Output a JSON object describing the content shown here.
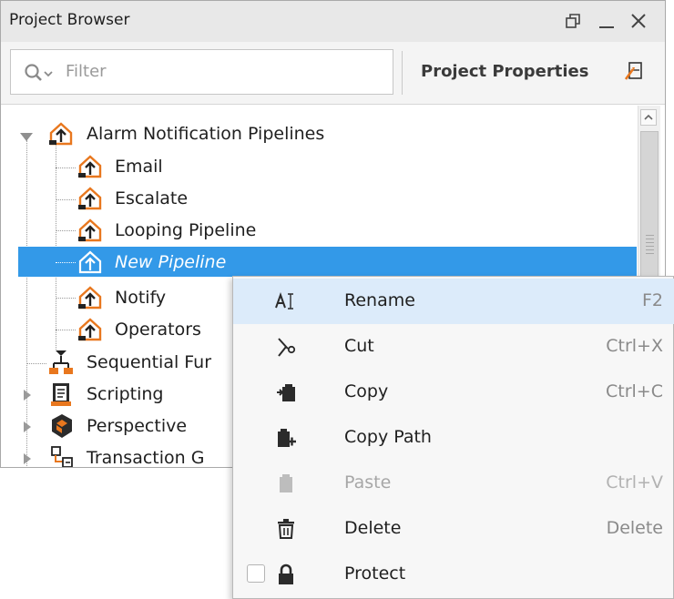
{
  "panel": {
    "title": "Project Browser",
    "filter_placeholder": "Filter",
    "project_properties_label": "Project Properties"
  },
  "tree": {
    "nodes": [
      {
        "label": "Alarm Notification Pipelines",
        "icon": "pipeline-icon",
        "expanded": true
      },
      {
        "label": "Email",
        "icon": "pipeline-icon"
      },
      {
        "label": "Escalate",
        "icon": "pipeline-icon"
      },
      {
        "label": "Looping Pipeline",
        "icon": "pipeline-icon"
      },
      {
        "label": "New Pipeline",
        "icon": "pipeline-icon",
        "selected": true
      },
      {
        "label": "Notify",
        "icon": "pipeline-icon"
      },
      {
        "label": "Operators",
        "icon": "pipeline-icon"
      },
      {
        "label": "Sequential Fur",
        "icon": "sfc-icon"
      },
      {
        "label": "Scripting",
        "icon": "script-icon"
      },
      {
        "label": "Perspective",
        "icon": "perspective-icon"
      },
      {
        "label": "Transaction G",
        "icon": "transaction-group-icon"
      }
    ]
  },
  "context_menu": {
    "items": [
      {
        "label": "Rename",
        "shortcut": "F2",
        "icon": "rename-icon",
        "highlighted": true
      },
      {
        "label": "Cut",
        "shortcut": "Ctrl+X",
        "icon": "scissors-icon"
      },
      {
        "label": "Copy",
        "shortcut": "Ctrl+C",
        "icon": "copy-icon"
      },
      {
        "label": "Copy Path",
        "shortcut": "",
        "icon": "copy-path-icon"
      },
      {
        "label": "Paste",
        "shortcut": "Ctrl+V",
        "icon": "paste-icon",
        "disabled": true
      },
      {
        "label": "Delete",
        "shortcut": "Delete",
        "icon": "trash-icon"
      },
      {
        "label": "Protect",
        "shortcut": "",
        "icon": "lock-icon",
        "checkbox": true
      }
    ]
  },
  "colors": {
    "selection": "#3399e8",
    "menu_highlight": "#dcebfa",
    "pipeline_icon": "#e8771e"
  }
}
